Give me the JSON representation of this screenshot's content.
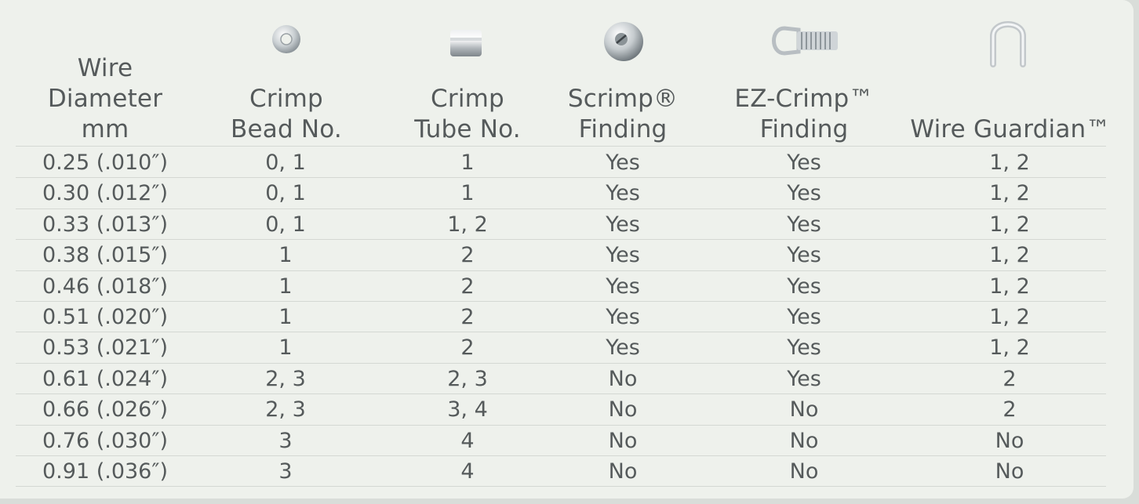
{
  "headers": {
    "wire_diameter": [
      "Wire",
      "Diameter",
      "mm"
    ],
    "crimp_bead": [
      "Crimp",
      "Bead No."
    ],
    "crimp_tube": [
      "Crimp",
      "Tube No."
    ],
    "scrimp": [
      "Scrimp®",
      "Finding"
    ],
    "ez_crimp": [
      "EZ-Crimp™",
      "Finding"
    ],
    "wire_guardian": [
      "Wire Guardian™"
    ]
  },
  "icons": [
    "crimp-bead-icon",
    "crimp-tube-icon",
    "scrimp-icon",
    "ez-crimp-icon",
    "wire-guardian-icon"
  ],
  "rows": [
    [
      "0.25 (.010″)",
      "0, 1",
      "1",
      "Yes",
      "Yes",
      "1, 2"
    ],
    [
      "0.30 (.012″)",
      "0, 1",
      "1",
      "Yes",
      "Yes",
      "1, 2"
    ],
    [
      "0.33 (.013″)",
      "0, 1",
      "1, 2",
      "Yes",
      "Yes",
      "1, 2"
    ],
    [
      "0.38 (.015″)",
      "1",
      "2",
      "Yes",
      "Yes",
      "1, 2"
    ],
    [
      "0.46 (.018″)",
      "1",
      "2",
      "Yes",
      "Yes",
      "1, 2"
    ],
    [
      "0.51 (.020″)",
      "1",
      "2",
      "Yes",
      "Yes",
      "1, 2"
    ],
    [
      "0.53 (.021″)",
      "1",
      "2",
      "Yes",
      "Yes",
      "1, 2"
    ],
    [
      "0.61 (.024″)",
      "2, 3",
      "2, 3",
      "No",
      "Yes",
      "2"
    ],
    [
      "0.66 (.026″)",
      "2, 3",
      "3, 4",
      "No",
      "No",
      "2"
    ],
    [
      "0.76 (.030″)",
      "3",
      "4",
      "No",
      "No",
      "No"
    ],
    [
      "0.91 (.036″)",
      "3",
      "4",
      "No",
      "No",
      "No"
    ]
  ],
  "colors": {
    "background": "#eef1ec",
    "text": "#555a5b",
    "divider": "#d4d8d3"
  }
}
